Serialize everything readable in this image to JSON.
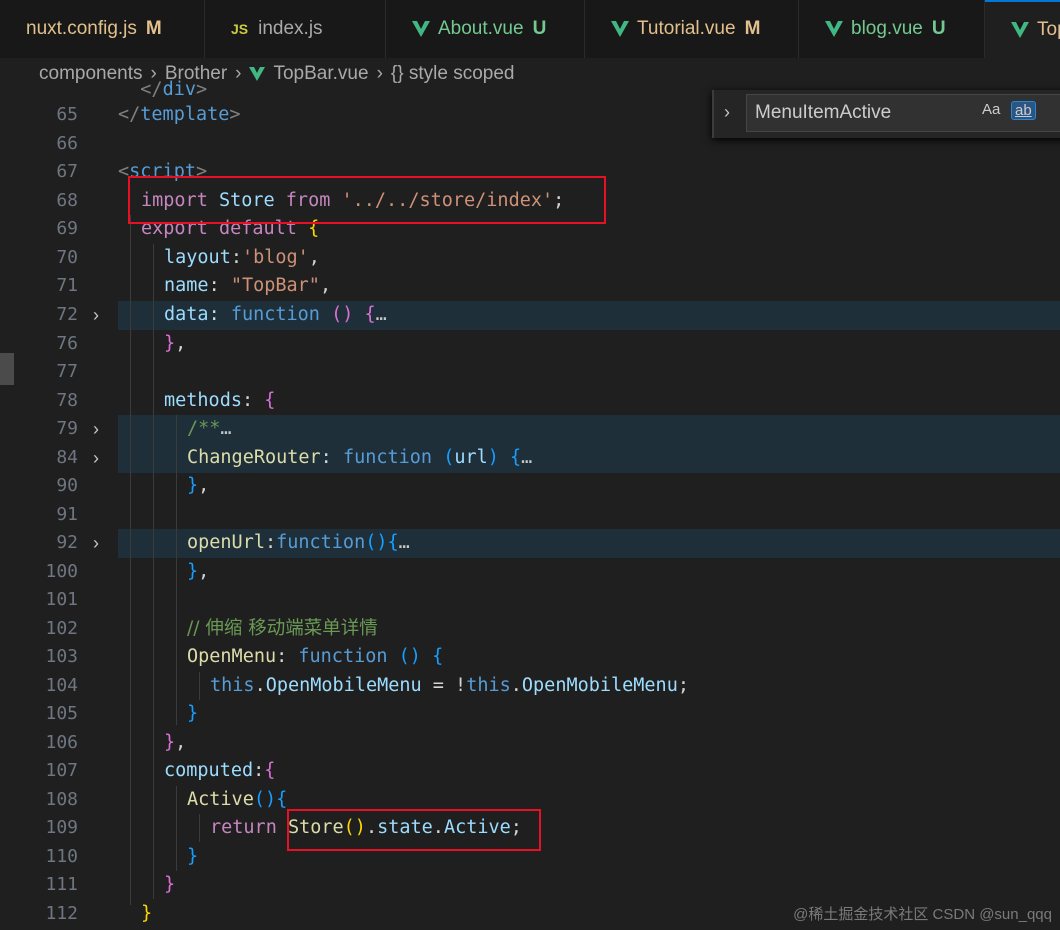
{
  "tabs": [
    {
      "label": "nuxt.config.js",
      "status": "M",
      "icon": "js-icon"
    },
    {
      "label": "index.js",
      "status": "",
      "icon": "js-icon"
    },
    {
      "label": "About.vue",
      "status": "U",
      "icon": "vue-icon"
    },
    {
      "label": "Tutorial.vue",
      "status": "M",
      "icon": "vue-icon"
    },
    {
      "label": "blog.vue",
      "status": "U",
      "icon": "vue-icon"
    },
    {
      "label": "Top",
      "status": "",
      "icon": "vue-icon"
    }
  ],
  "js_badge": "JS",
  "breadcrumb": {
    "part1": "components",
    "part2": "Brother",
    "part3": "TopBar.vue",
    "part4": "{} style scoped"
  },
  "find": {
    "value": "MenuItemActive",
    "opt_case": "Aa",
    "opt_word": "ab"
  },
  "lines": {
    "n65": "65",
    "n66": "66",
    "n67": "67",
    "n68": "68",
    "n69": "69",
    "n70": "70",
    "n71": "71",
    "n72": "72",
    "n76": "76",
    "n77": "77",
    "n78": "78",
    "n79": "79",
    "n84": "84",
    "n90": "90",
    "n91": "91",
    "n92": "92",
    "n100": "100",
    "n101": "101",
    "n102": "102",
    "n103": "103",
    "n104": "104",
    "n105": "105",
    "n106": "106",
    "n107": "107",
    "n108": "108",
    "n109": "109",
    "n110": "110",
    "n111": "111",
    "n112": "112"
  },
  "code": {
    "template_close": "template",
    "script_open": "script",
    "import_kw": "import",
    "import_name": " Store ",
    "import_from": "from",
    "import_path": " '../../store/index'",
    "import_semi": ";",
    "export": "export",
    "default": " default ",
    "layout_key": "layout",
    "layout_val": "'blog'",
    "name_key": "name",
    "name_val": "\"TopBar\"",
    "data_key": "data",
    "function_kw": "function",
    "methods_key": "methods",
    "doc_comment": "/**",
    "change_router": "ChangeRouter",
    "url_param": "url",
    "open_url": "openUrl",
    "comment_cn": "// 伸缩 移动端菜单详情",
    "open_menu": "OpenMenu",
    "this_kw": "this",
    "open_mobile_menu": "OpenMobileMenu",
    "computed_key": "computed",
    "active_fn": "Active",
    "return_kw": "return",
    "store_call": "Store",
    "state": "state",
    "active_prop": "Active"
  },
  "watermark": "@稀土掘金技术社区 CSDN @sun_qqq"
}
